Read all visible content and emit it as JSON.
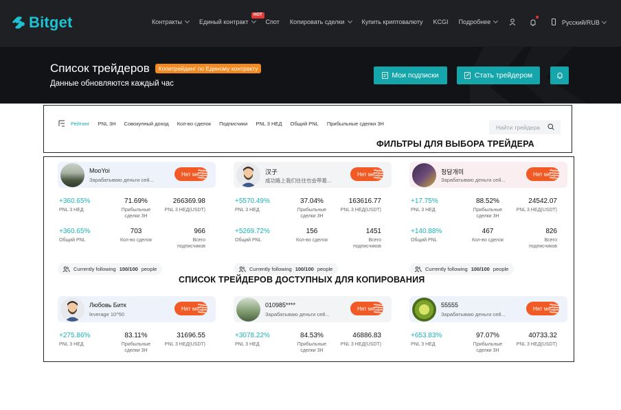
{
  "nav": {
    "logo": "Bitget",
    "menu": [
      {
        "label": "Контракты",
        "chev": true
      },
      {
        "label": "Единый контракт",
        "chev": true,
        "badge": "HOT"
      },
      {
        "label": "Спот",
        "chev": false
      },
      {
        "label": "Копировать сделки",
        "chev": true
      },
      {
        "label": "Купить криптовалюту",
        "chev": false
      },
      {
        "label": "KCGI",
        "chev": false
      },
      {
        "label": "Подробнее",
        "chev": true
      }
    ],
    "lang": "Русский/RUB"
  },
  "hero": {
    "title": "Список трейдеров",
    "tag": "Копитрейдинг по Единому контракту",
    "subtitle": "Данные обновляются каждый час",
    "btn_subscriptions": "Мои подписки",
    "btn_become": "Стать трейдером"
  },
  "filters": {
    "tabs": [
      "Рейтинг",
      "PNL 3Н",
      "Совокупный доход",
      "Кол-во сделок",
      "Подписчики",
      "PNL 3 НЕД",
      "Общий PNL",
      "Прибыльные сделки 3Н"
    ],
    "search_placeholder": "Найти трейдера",
    "annotation": "ФИЛЬТРЫ ДЛЯ ВЫБОРА ТРЕЙДЕРА"
  },
  "list_annotation": "СПИСОК ТРЕЙДЕРОВ ДОСТУПНЫХ ДЛЯ КОПИРОВАНИЯ",
  "labels": {
    "pnl3w": "PNL 3 НЕД",
    "profitable": "Прибыльные сделки 3Н",
    "pnl3w_usdt": "PNL 3 НЕД(USDT)",
    "total_pnl": "Общий PNL",
    "trades": "Кол-во сделок",
    "subs": "Всего подписчиков",
    "follow_pre": "Currently following",
    "follow_val": "100/100",
    "follow_post": "people",
    "button": "Нет ме"
  },
  "traders": [
    {
      "name": "MooYoi",
      "desc": "Зарабатываю деньги сей...",
      "roi": "+360.65%",
      "win": "71.69%",
      "pnl": "266369.98",
      "total": "+360.65%",
      "trades": "703",
      "subs": "966",
      "bg": "#eef3fb"
    },
    {
      "name": "汉子",
      "desc": "成功路上我们往往也会带着...",
      "roi": "+5570.49%",
      "win": "37.04%",
      "pnl": "163616.77",
      "total": "+5269.72%",
      "trades": "156",
      "subs": "1451",
      "bg": "#f3f4f6"
    },
    {
      "name": "청담개미",
      "desc": "Зарабатываю деньги сей...",
      "roi": "+17.75%",
      "win": "88.52%",
      "pnl": "24542.07",
      "total": "+140.88%",
      "trades": "467",
      "subs": "826",
      "bg": "#fbeef0"
    },
    {
      "name": "Любовь Битк",
      "desc": "leverage 10^50",
      "roi": "+275.86%",
      "win": "83.11%",
      "pnl": "31696.55",
      "bg": "#eef3fb"
    },
    {
      "name": "010985****",
      "desc": "Зарабатываю деньги сей...",
      "roi": "+3078.22%",
      "win": "84.53%",
      "pnl": "46886.83",
      "bg": "#f3f4f6"
    },
    {
      "name": "55555",
      "desc": "Зарабатываю деньги сей...",
      "roi": "+653.83%",
      "win": "97.07%",
      "pnl": "40733.32",
      "bg": "#eef3fb"
    }
  ]
}
